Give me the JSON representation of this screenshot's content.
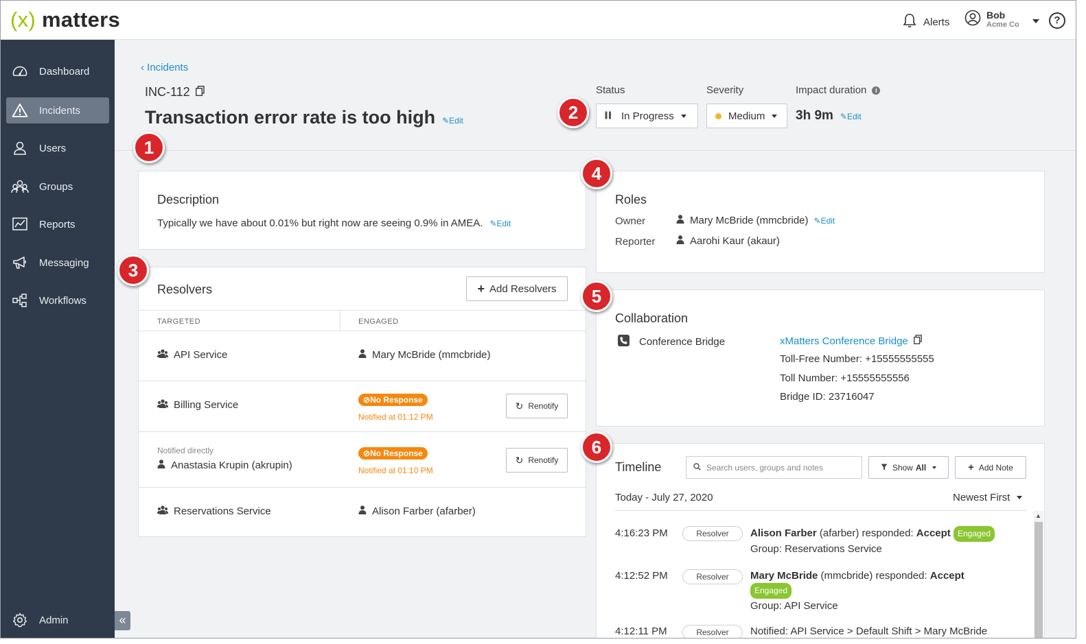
{
  "app": {
    "logo_prefix": "(x)",
    "logo_suffix": "matters"
  },
  "topbar": {
    "alerts_label": "Alerts",
    "user_name": "Bob",
    "user_org": "Acme Co",
    "help_glyph": "?"
  },
  "sidebar": {
    "items": [
      {
        "label": "Dashboard",
        "icon": "dashboard-icon"
      },
      {
        "label": "Incidents",
        "icon": "warning-icon",
        "active": true
      },
      {
        "label": "Users",
        "icon": "user-icon"
      },
      {
        "label": "Groups",
        "icon": "group-icon"
      },
      {
        "label": "Reports",
        "icon": "reports-icon"
      },
      {
        "label": "Messaging",
        "icon": "megaphone-icon"
      },
      {
        "label": "Workflows",
        "icon": "workflow-icon"
      }
    ],
    "admin_label": "Admin",
    "collapse_glyph": "«"
  },
  "header": {
    "back_link": "‹ Incidents",
    "incident_id": "INC-112",
    "title": "Transaction error rate is too high",
    "edit_label": "Edit",
    "status_label": "Status",
    "status_value": "In Progress",
    "severity_label": "Severity",
    "severity_value": "Medium",
    "impact_label": "Impact duration",
    "impact_value": "3h 9m"
  },
  "description": {
    "title": "Description",
    "text": "Typically we have about 0.01% but right now are seeing 0.9% in AMEA.",
    "edit_label": "Edit"
  },
  "resolvers": {
    "title": "Resolvers",
    "add_button": "Add Resolvers",
    "col_targeted": "TARGETED",
    "col_engaged": "ENGAGED",
    "renotify_label": "Renotify",
    "rows": [
      {
        "targeted": "API Service",
        "engaged": "Mary McBride (mmcbride)"
      },
      {
        "targeted": "Billing Service",
        "status": "No Response",
        "notified": "Notified at 01:12 PM"
      },
      {
        "note": "Notified directly",
        "targeted": "Anastasia Krupin (akrupin)",
        "status": "No Response",
        "notified": "Notified at 01:10 PM"
      },
      {
        "targeted": "Reservations Service",
        "engaged": "Alison Farber (afarber)"
      }
    ]
  },
  "roles": {
    "title": "Roles",
    "owner_label": "Owner",
    "owner_value": "Mary McBride (mmcbride)",
    "reporter_label": "Reporter",
    "reporter_value": "Aarohi Kaur (akaur)",
    "edit_label": "Edit"
  },
  "collaboration": {
    "title": "Collaboration",
    "bridge_label": "Conference Bridge",
    "bridge_link": "xMatters Conference Bridge",
    "toll_free": "Toll-Free Number: +15555555555",
    "toll": "Toll Number: +15555555556",
    "bridge_id": "Bridge ID: 23716047"
  },
  "timeline": {
    "title": "Timeline",
    "search_placeholder": "Search users, groups and notes",
    "show_label": "Show",
    "show_value": "All",
    "add_note": "Add Note",
    "date_label": "Today - July 27, 2020",
    "sort_label": "Newest First",
    "entries": [
      {
        "time": "4:16:23 PM",
        "type": "Resolver",
        "name": "Alison Farber",
        "handle": "(afarber) responded:",
        "action": "Accept",
        "badge": "Engaged",
        "detail": "Group: Reservations Service"
      },
      {
        "time": "4:12:52 PM",
        "type": "Resolver",
        "name": "Mary McBride",
        "handle": "(mmcbride) responded:",
        "action": "Accept",
        "badge": "Engaged",
        "detail": "Group: API Service"
      },
      {
        "time": "4:12:11 PM",
        "type": "Resolver",
        "text": "Notified: API Service > Default Shift > Mary McBride"
      }
    ]
  },
  "markers": [
    "1",
    "2",
    "3",
    "4",
    "5",
    "6"
  ],
  "colors": {
    "accent": "#1b8fc9",
    "sidebar": "#2f3b4a",
    "logo_green": "#9ac400",
    "warning": "#f5880f",
    "engaged": "#8ac630",
    "marker": "#d9262b"
  }
}
